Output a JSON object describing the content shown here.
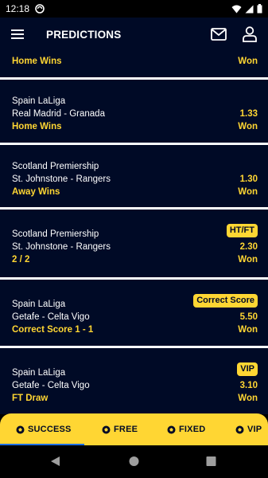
{
  "status_bar": {
    "time": "12:18"
  },
  "app_bar": {
    "title": "PREDICTIONS"
  },
  "predictions": [
    {
      "league": "",
      "match": "",
      "tip": "Home Wins",
      "badge": "",
      "odds": "",
      "result": "Won"
    },
    {
      "league": "Spain LaLiga",
      "match": "Real Madrid - Granada",
      "tip": "Home Wins",
      "badge": "",
      "odds": "1.33",
      "result": "Won"
    },
    {
      "league": "Scotland Premiership",
      "match": "St. Johnstone - Rangers",
      "tip": "Away Wins",
      "badge": "",
      "odds": "1.30",
      "result": "Won"
    },
    {
      "league": "Scotland Premiership",
      "match": "St. Johnstone - Rangers",
      "tip": "2 / 2",
      "badge": "HT/FT",
      "odds": "2.30",
      "result": "Won"
    },
    {
      "league": "Spain LaLiga",
      "match": "Getafe - Celta Vigo",
      "tip": "Correct Score 1 - 1",
      "badge": "Correct Score",
      "odds": "5.50",
      "result": "Won"
    },
    {
      "league": "Spain LaLiga",
      "match": "Getafe - Celta Vigo",
      "tip": "FT Draw",
      "badge": "VIP",
      "odds": "3.10",
      "result": "Won"
    }
  ],
  "bottom_nav": {
    "success": "SUCCESS",
    "free": "FREE",
    "fixed": "FIXED",
    "vip": "VIP",
    "active": "success"
  },
  "colors": {
    "accent": "#ffd633",
    "background": "#000a26",
    "separator": "#ffffff",
    "indicator": "#1d6fe3"
  },
  "icons": {
    "menu": "hamburger-menu-icon",
    "mail": "mail-icon",
    "account": "account-icon",
    "ball": "soccer-ball-icon"
  }
}
